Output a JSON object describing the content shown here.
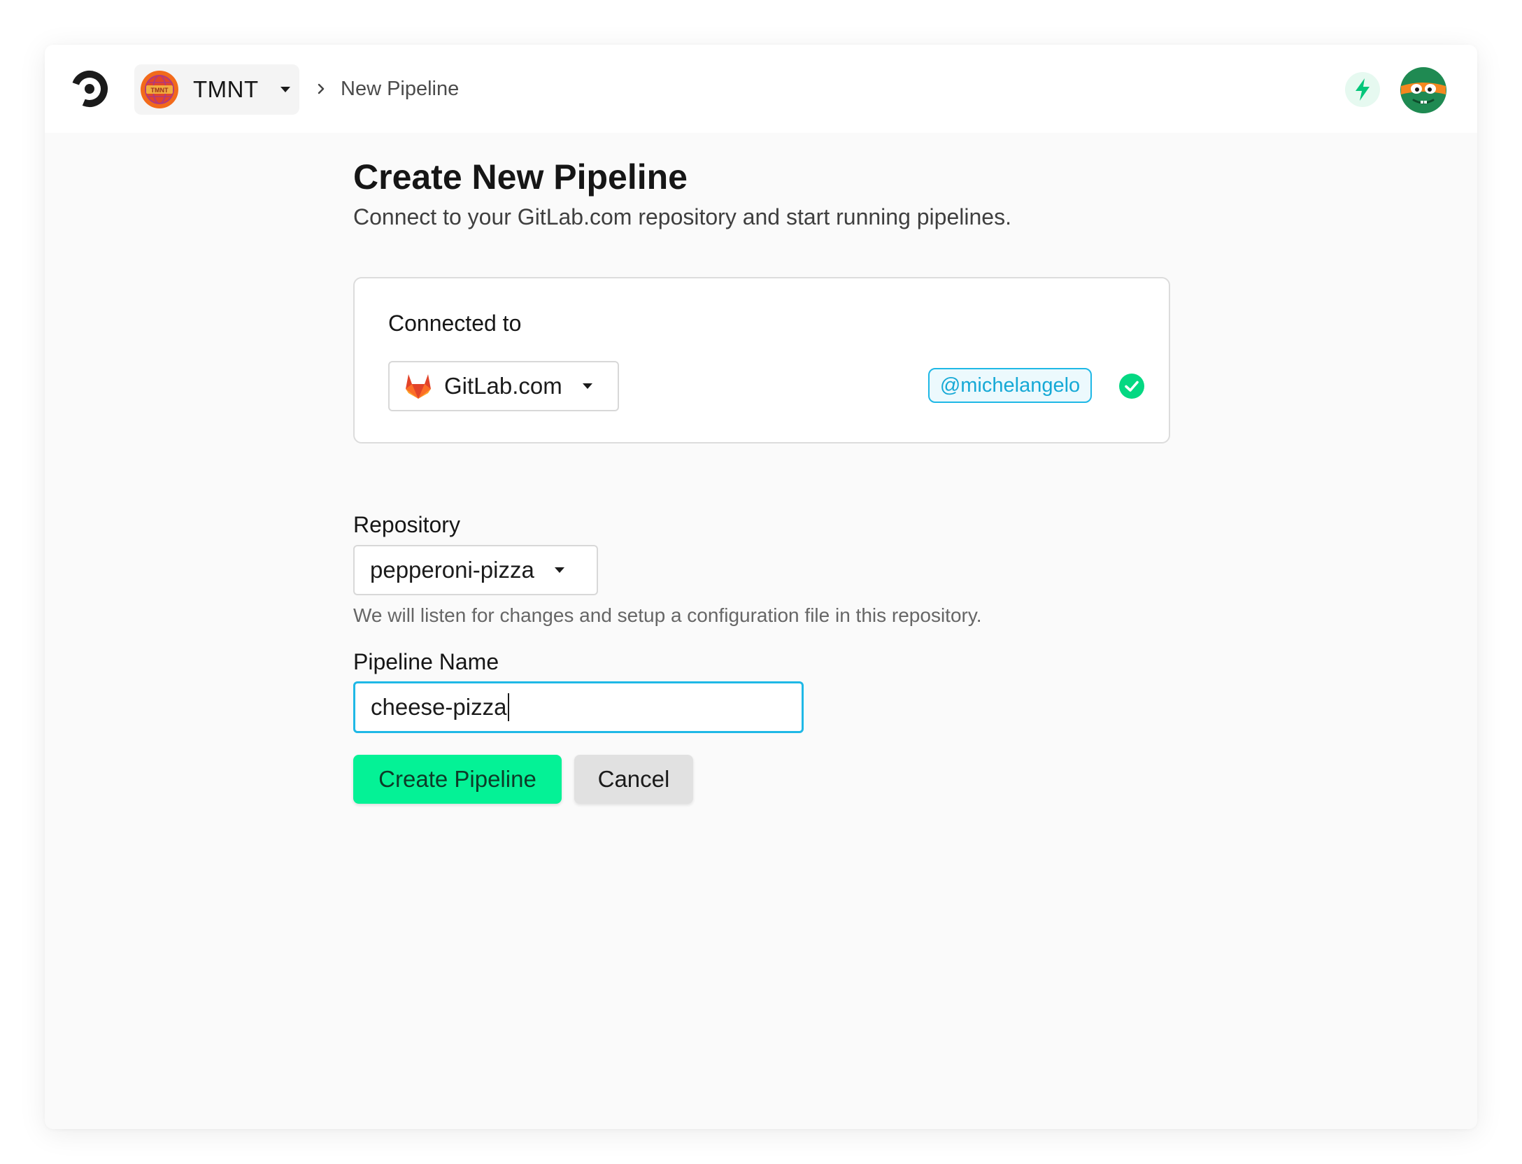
{
  "colors": {
    "accent": "#04f296",
    "focus": "#1fb8e6",
    "background": "#fafafa",
    "card": "#ffffff"
  },
  "header": {
    "logo_icon": "circleci-logo-icon",
    "org": {
      "name": "TMNT",
      "avatar_icon": "tmnt-org-avatar"
    },
    "breadcrumb": {
      "separator_icon": "chevron-right-icon",
      "current": "New Pipeline"
    },
    "actions": {
      "bolt_icon": "bolt-icon",
      "user_avatar_icon": "turtle-avatar"
    }
  },
  "page": {
    "title": "Create New Pipeline",
    "subtitle": "Connect to your GitLab.com repository and start running pipelines."
  },
  "connection": {
    "label": "Connected to",
    "provider": {
      "name": "GitLab.com",
      "icon": "gitlab-icon"
    },
    "username": "@michelangelo",
    "status_icon": "check-circle-icon"
  },
  "repository": {
    "label": "Repository",
    "selected": "pepperoni-pizza",
    "help": "We will listen for changes and setup a configuration file in this repository."
  },
  "pipeline_name": {
    "label": "Pipeline Name",
    "value": "cheese-pizza"
  },
  "buttons": {
    "create": "Create Pipeline",
    "cancel": "Cancel"
  }
}
